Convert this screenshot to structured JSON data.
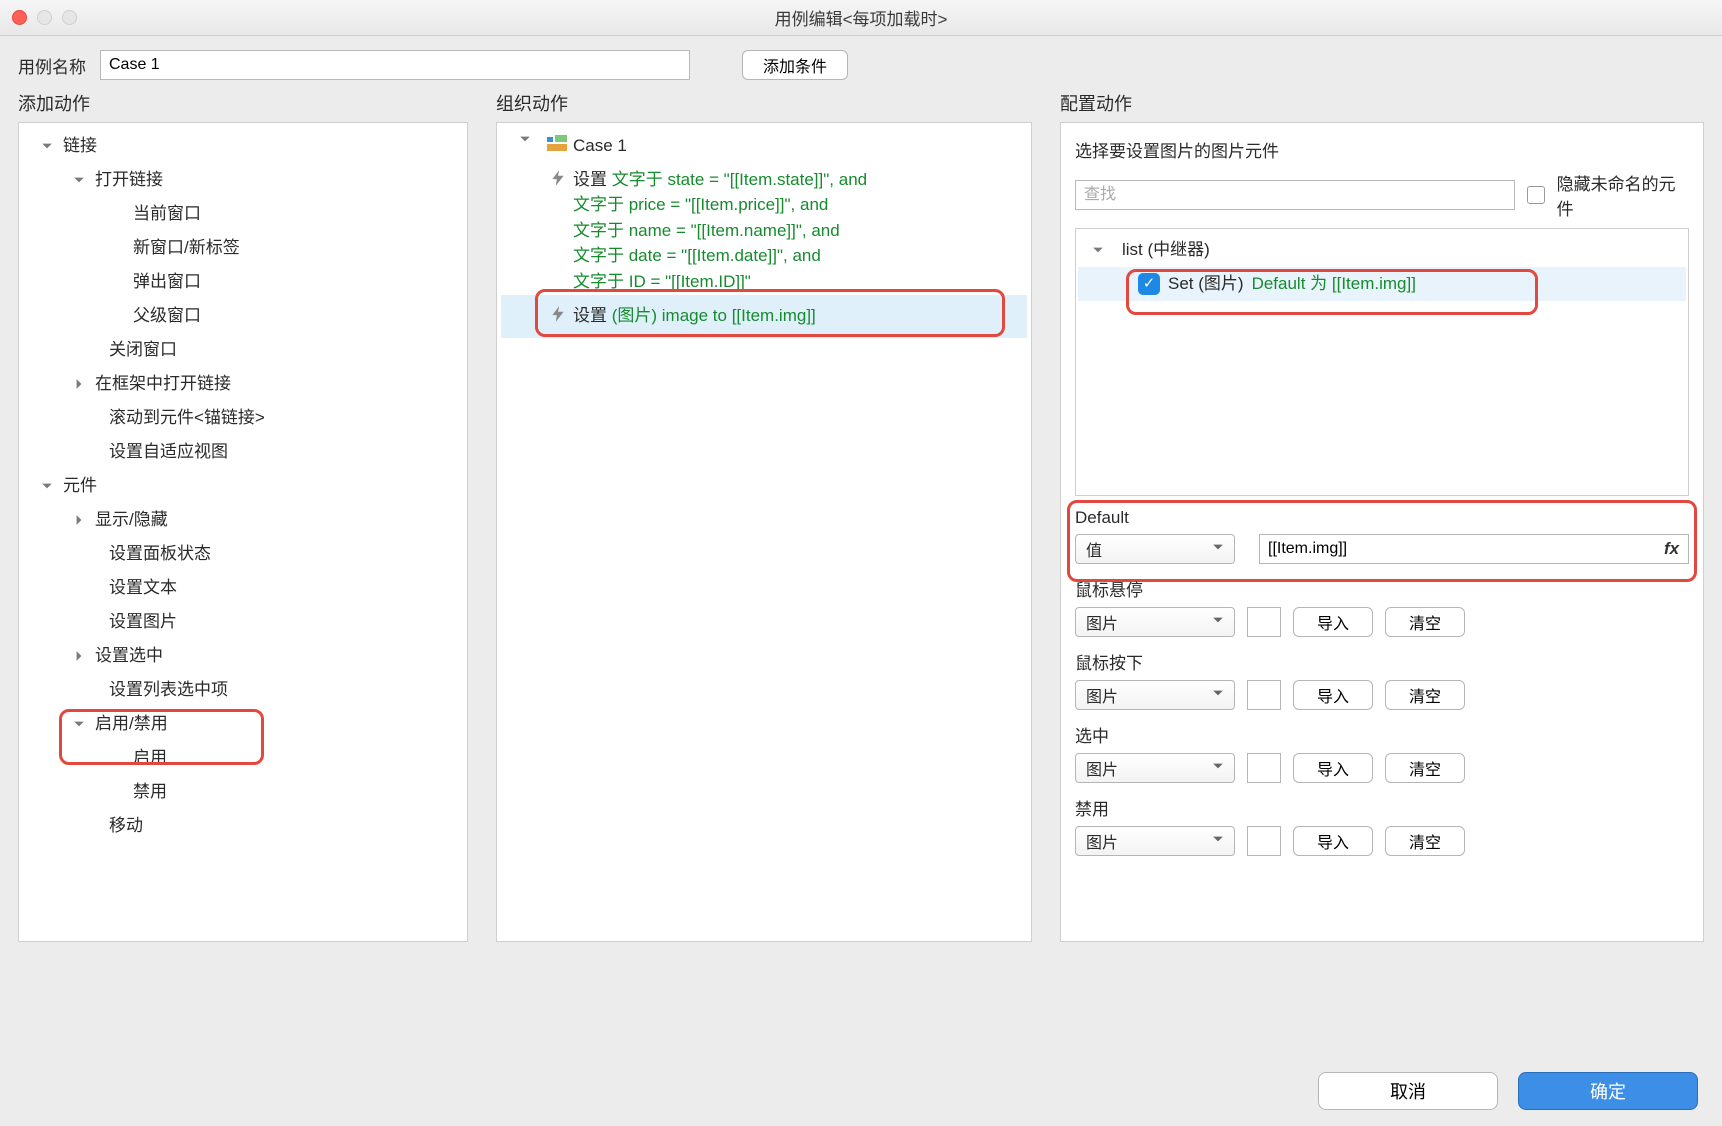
{
  "window": {
    "title": "用例编辑<每项加载时>"
  },
  "top": {
    "name_label": "用例名称",
    "name_value": "Case 1",
    "add_condition": "添加条件"
  },
  "headers": {
    "add_action": "添加动作",
    "organize": "组织动作",
    "config": "配置动作"
  },
  "actions_tree": {
    "link": {
      "label": "链接"
    },
    "open_link": {
      "label": "打开链接"
    },
    "current_window": "当前窗口",
    "new_window": "新窗口/新标签",
    "popup": "弹出窗口",
    "parent": "父级窗口",
    "close_window": "关闭窗口",
    "open_in_frame": "在框架中打开链接",
    "scroll_to": "滚动到元件<锚链接>",
    "set_adaptive": "设置自适应视图",
    "widget": {
      "label": "元件"
    },
    "show_hide": "显示/隐藏",
    "set_panel_state": "设置面板状态",
    "set_text": "设置文本",
    "set_image": "设置图片",
    "set_selected": "设置选中",
    "set_list_selected": "设置列表选中项",
    "enable_disable": {
      "label": "启用/禁用"
    },
    "enable": "启用",
    "disable": "禁用",
    "move": "移动"
  },
  "case_tree": {
    "case_name": "Case 1",
    "action1_prefix": "设置",
    "action1_lines": [
      "文字于 state = \"[[Item.state]]\", and",
      "文字于 price = \"[[Item.price]]\", and",
      "文字于 name = \"[[Item.name]]\", and",
      "文字于 date = \"[[Item.date]]\", and",
      "文字于 ID = \"[[Item.ID]]\""
    ],
    "action2_prefix": "设置",
    "action2_text": "(图片) image to [[Item.img]]"
  },
  "config": {
    "section_title": "选择要设置图片的图片元件",
    "search_placeholder": "查找",
    "hide_unnamed": "隐藏未命名的元件",
    "repeater": "list (中继器)",
    "set_item_prefix": "Set (图片)",
    "set_item_suffix": "Default 为 [[Item.img]]",
    "default": {
      "label": "Default",
      "select": "值",
      "value": "[[Item.img]]",
      "fx": "fx"
    },
    "hover": {
      "label": "鼠标悬停",
      "select": "图片",
      "import": "导入",
      "clear": "清空"
    },
    "down": {
      "label": "鼠标按下",
      "select": "图片",
      "import": "导入",
      "clear": "清空"
    },
    "selected": {
      "label": "选中",
      "select": "图片",
      "import": "导入",
      "clear": "清空"
    },
    "disabled": {
      "label": "禁用",
      "select": "图片",
      "import": "导入",
      "clear": "清空"
    }
  },
  "footer": {
    "cancel": "取消",
    "ok": "确定"
  }
}
